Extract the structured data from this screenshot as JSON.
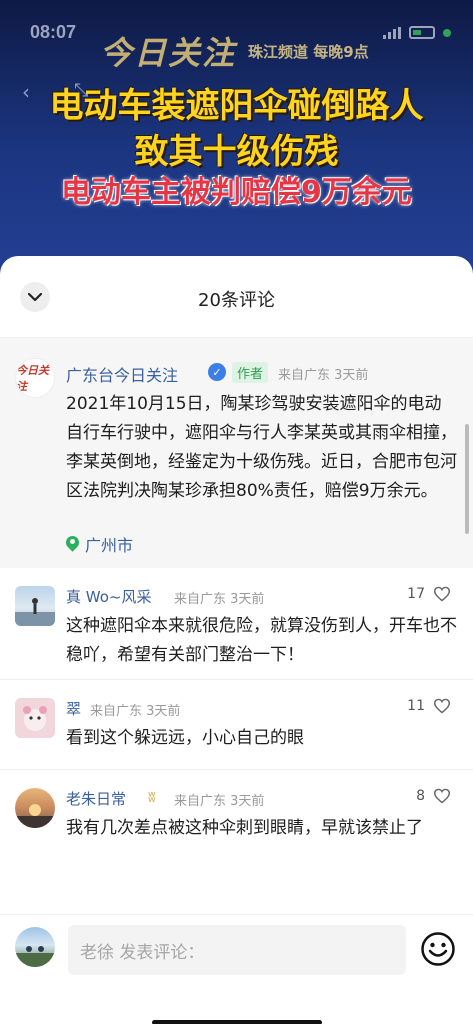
{
  "status_bar": {
    "time": "08:07"
  },
  "video": {
    "program_logo": "今日关注",
    "channel_info": "珠江频道 每晚9点",
    "headline_line1": "电动车装遮阳伞碰倒路人",
    "headline_line2": "致其十级伤残",
    "headline_line3": "电动车主被判赔偿9万余元"
  },
  "comments_sheet": {
    "title": "20条评论",
    "pinned": {
      "avatar_text": "今日关注",
      "name": "广东台今日关注",
      "author_tag": "作者",
      "meta": "来自广东 3天前",
      "text": "2021年10月15日，陶某珍驾驶安装遮阳伞的电动自行车行驶中，遮阳伞与行人李某英或其雨伞相撞，李某英倒地，经鉴定为十级伤残。近日，合肥市包河区法院判决陶某珍承担80%责任，赔偿9万余元。",
      "location": "广州市"
    },
    "comments": [
      {
        "name": "真 Wo~风采",
        "meta": "来自广东 3天前",
        "likes": "17",
        "text": "这种遮阳伞本来就很危险，就算没伤到人，开车也不稳吖，希望有关部门整治一下！"
      },
      {
        "name": "翠",
        "meta": "来自广东 3天前",
        "likes": "11",
        "text": "看到这个躲远远，小心自己的眼"
      },
      {
        "name": "老朱日常",
        "meta": "来自广东 3天前",
        "likes": "8",
        "text": "我有几次差点被这种伞刺到眼睛，早就该禁止了"
      }
    ],
    "input": {
      "placeholder": "老徐 发表评论："
    }
  }
}
